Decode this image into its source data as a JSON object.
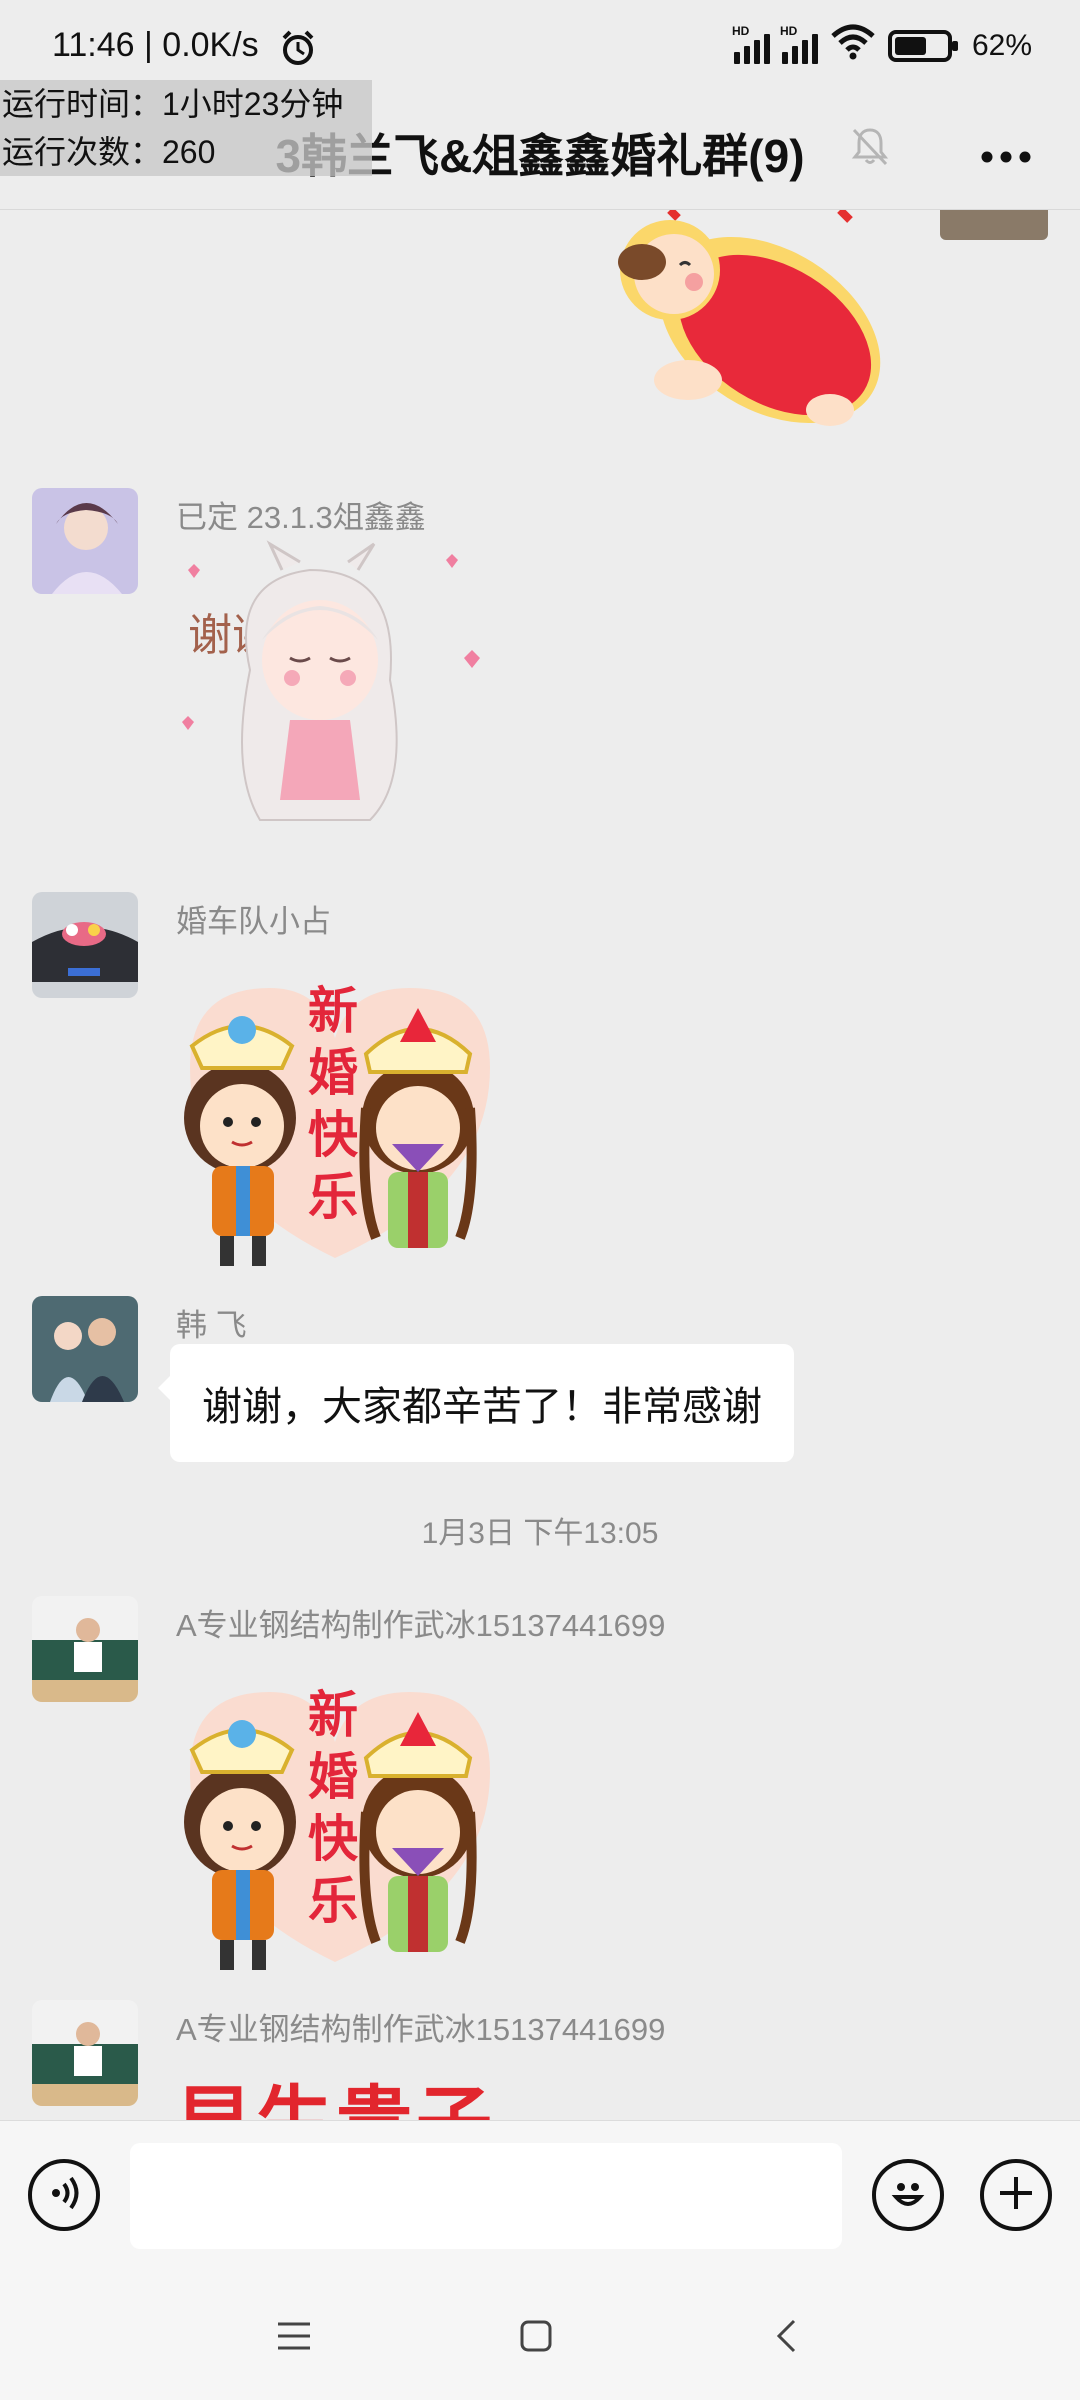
{
  "status_bar": {
    "time": "11:46 | 0.0K/s",
    "battery": "62%",
    "battery_level": 0.62,
    "hd_label": "HD"
  },
  "overlay": {
    "line1": "运行时间：1小时23分钟",
    "line2": "运行次数：260"
  },
  "header": {
    "title": "3韩兰飞&俎鑫鑫婚礼群(9)"
  },
  "messages": [
    {
      "sender": "已定 23.1.3俎鑫鑫",
      "sticker_text": "谢谢"
    },
    {
      "sender": "婚车队小占",
      "sticker_text": "新婚快乐"
    },
    {
      "sender": "韩 飞",
      "text": "谢谢，大家都辛苦了！非常感谢"
    },
    {
      "timestamp": "1月3日 下午13:05"
    },
    {
      "sender": "A专业钢结构制作武冰15137441699",
      "sticker_text": "新婚快乐"
    },
    {
      "sender": "A专业钢结构制作武冰15137441699",
      "sticker_text": "早生贵子"
    }
  ],
  "input": {
    "value": "",
    "placeholder": ""
  },
  "icons": {
    "voice": "voice-icon",
    "emoji": "emoji-icon",
    "plus": "plus-icon",
    "bell": "mute-bell-icon",
    "more": "more-icon",
    "menu": "menu-icon",
    "home": "home-icon",
    "back": "back-icon"
  }
}
